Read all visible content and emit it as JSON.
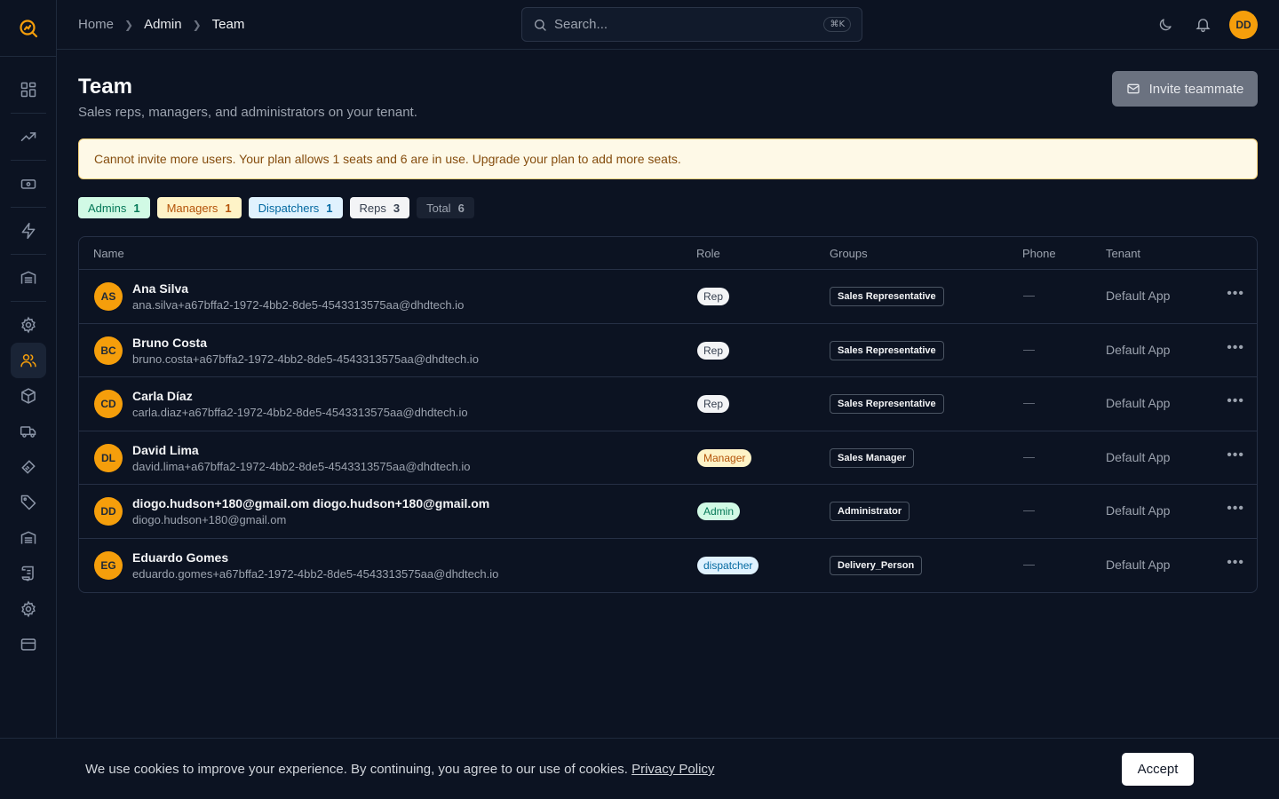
{
  "header": {
    "breadcrumb": [
      "Home",
      "Admin",
      "Team"
    ],
    "search_placeholder": "Search...",
    "search_shortcut": "⌘K",
    "user_initials": "DD"
  },
  "page": {
    "title": "Team",
    "subtitle": "Sales reps, managers, and administrators on your tenant.",
    "invite_label": "Invite teammate",
    "alert": "Cannot invite more users. Your plan allows 1 seats and 6 are in use. Upgrade your plan to add more seats."
  },
  "chips": [
    {
      "label": "Admins",
      "count": "1"
    },
    {
      "label": "Managers",
      "count": "1"
    },
    {
      "label": "Dispatchers",
      "count": "1"
    },
    {
      "label": "Reps",
      "count": "3"
    },
    {
      "label": "Total",
      "count": "6"
    }
  ],
  "table": {
    "headers": [
      "Name",
      "Role",
      "Groups",
      "Phone",
      "Tenant"
    ],
    "rows": [
      {
        "initials": "AS",
        "name": "Ana Silva",
        "email": "ana.silva+a67bffa2-1972-4bb2-8de5-4543313575aa@dhdtech.io",
        "role": "Rep",
        "group": "Sales Representative",
        "phone": "—",
        "tenant": "Default App"
      },
      {
        "initials": "BC",
        "name": "Bruno Costa",
        "email": "bruno.costa+a67bffa2-1972-4bb2-8de5-4543313575aa@dhdtech.io",
        "role": "Rep",
        "group": "Sales Representative",
        "phone": "—",
        "tenant": "Default App"
      },
      {
        "initials": "CD",
        "name": "Carla Díaz",
        "email": "carla.diaz+a67bffa2-1972-4bb2-8de5-4543313575aa@dhdtech.io",
        "role": "Rep",
        "group": "Sales Representative",
        "phone": "—",
        "tenant": "Default App"
      },
      {
        "initials": "DL",
        "name": "David Lima",
        "email": "david.lima+a67bffa2-1972-4bb2-8de5-4543313575aa@dhdtech.io",
        "role": "Manager",
        "group": "Sales Manager",
        "phone": "—",
        "tenant": "Default App"
      },
      {
        "initials": "DD",
        "name": "diogo.hudson+180@gmail.om diogo.hudson+180@gmail.om",
        "email": "diogo.hudson+180@gmail.om",
        "role": "Admin",
        "group": "Administrator",
        "phone": "—",
        "tenant": "Default App"
      },
      {
        "initials": "EG",
        "name": "Eduardo Gomes",
        "email": "eduardo.gomes+a67bffa2-1972-4bb2-8de5-4543313575aa@dhdtech.io",
        "role": "dispatcher",
        "group": "Delivery_Person",
        "phone": "—",
        "tenant": "Default App"
      }
    ]
  },
  "cookie": {
    "text": "We use cookies to improve your experience. By continuing, you agree to our use of cookies.",
    "link": "Privacy Policy",
    "accept": "Accept"
  },
  "colors": {
    "background": "#0c1322",
    "accent": "#f59e0b",
    "alert_bg": "#fef9e7",
    "alert_text": "#854d0e"
  }
}
